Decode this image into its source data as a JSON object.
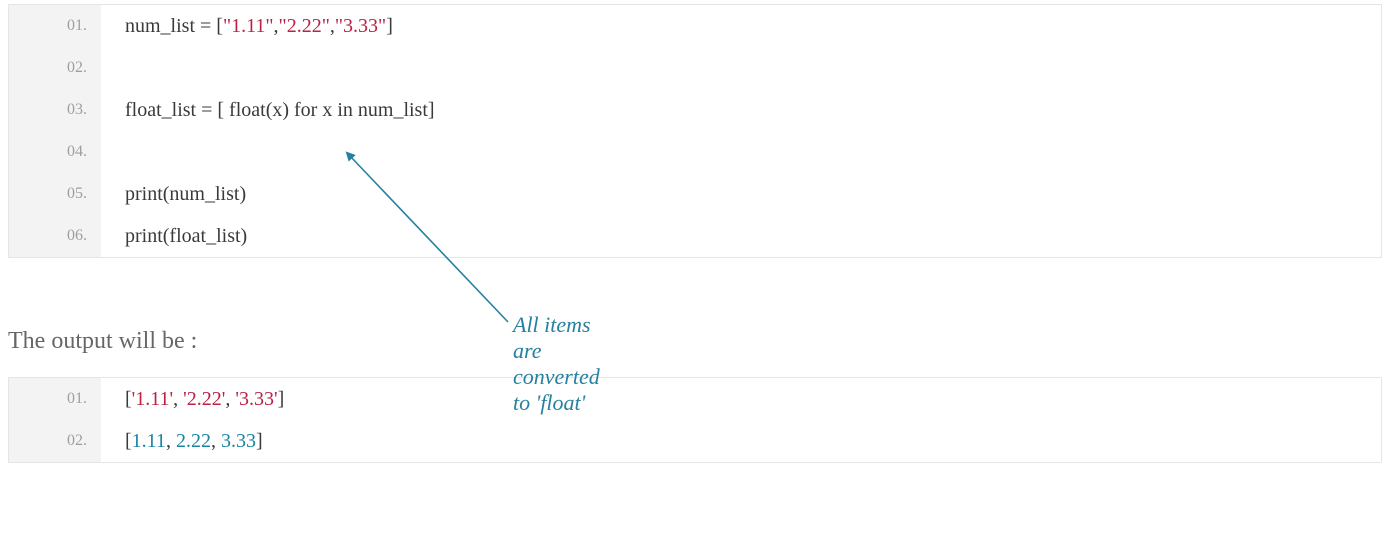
{
  "code1": {
    "lines": [
      "01.",
      "02.",
      "03.",
      "04.",
      "05.",
      "06."
    ],
    "l1_pre": "num_list = [",
    "l1_s1": "\"1.11\"",
    "l1_c1": ",",
    "l1_s2": "\"2.22\"",
    "l1_c2": ",",
    "l1_s3": "\"3.33\"",
    "l1_post": "]",
    "l3": "float_list = [ float(x) for x in num_list]",
    "l5": "print(num_list)",
    "l6": "print(float_list)"
  },
  "annotation": "All items are converted to 'float'",
  "prose": "The output will be :",
  "code2": {
    "lines": [
      "01.",
      "02."
    ],
    "o1_open": "[",
    "o1_s1": "'1.11'",
    "o1_c1": ", ",
    "o1_s2": "'2.22'",
    "o1_c2": ", ",
    "o1_s3": "'3.33'",
    "o1_close": "]",
    "o2_open": "[",
    "o2_n1": "1.11",
    "o2_c1": ", ",
    "o2_n2": "2.22",
    "o2_c2": ", ",
    "o2_n3": "3.33",
    "o2_close": "]"
  }
}
